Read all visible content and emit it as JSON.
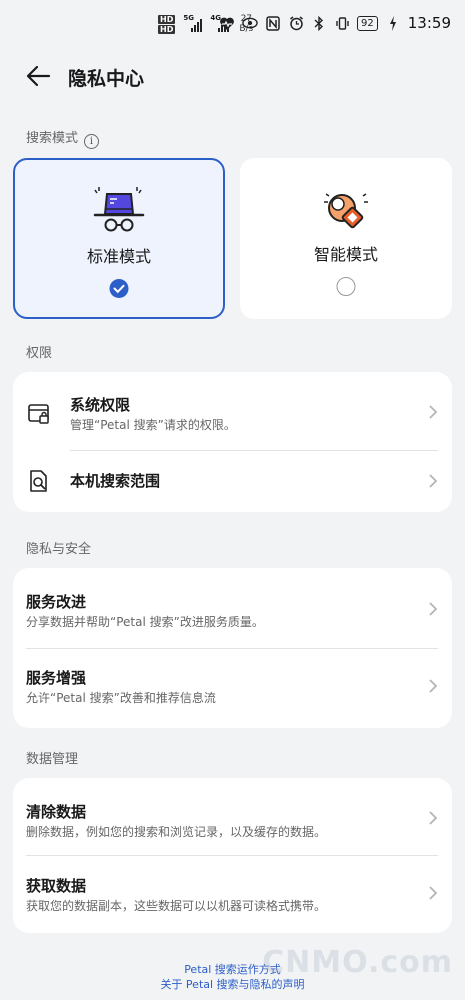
{
  "status_bar": {
    "sim1": "HD",
    "sim2": "HD",
    "net1": "5G",
    "net2": "4G",
    "speed_value": "27",
    "speed_unit": "B/s",
    "battery": "92",
    "time": "13:59"
  },
  "header": {
    "title": "隐私中心"
  },
  "search_mode": {
    "section_label": "搜索模式",
    "options": [
      {
        "label": "标准模式",
        "selected": true
      },
      {
        "label": "智能模式",
        "selected": false
      }
    ]
  },
  "permissions": {
    "section_label": "权限",
    "items": [
      {
        "title": "系统权限",
        "subtitle": "管理“Petal 搜索”请求的权限。",
        "icon": "app-lock-icon"
      },
      {
        "title": "本机搜索范围",
        "subtitle": "",
        "icon": "file-search-icon"
      }
    ]
  },
  "privacy_security": {
    "section_label": "隐私与安全",
    "items": [
      {
        "title": "服务改进",
        "subtitle": "分享数据并帮助“Petal 搜索”改进服务质量。"
      },
      {
        "title": "服务增强",
        "subtitle": "允许“Petal 搜索”改善和推荐信息流"
      }
    ]
  },
  "data_management": {
    "section_label": "数据管理",
    "items": [
      {
        "title": "清除数据",
        "subtitle": "删除数据，例如您的搜索和浏览记录，以及缓存的数据。"
      },
      {
        "title": "获取数据",
        "subtitle": "获取您的数据副本，这些数据可以以机器可读格式携带。"
      }
    ]
  },
  "footer": {
    "link1": "Petal 搜索运作方式",
    "link2": "关于 Petal 搜索与隐私的声明"
  },
  "watermark": "CNMO.com",
  "colors": {
    "accent": "#2d5fc8",
    "background": "#f1f3f5",
    "card": "#ffffff"
  }
}
